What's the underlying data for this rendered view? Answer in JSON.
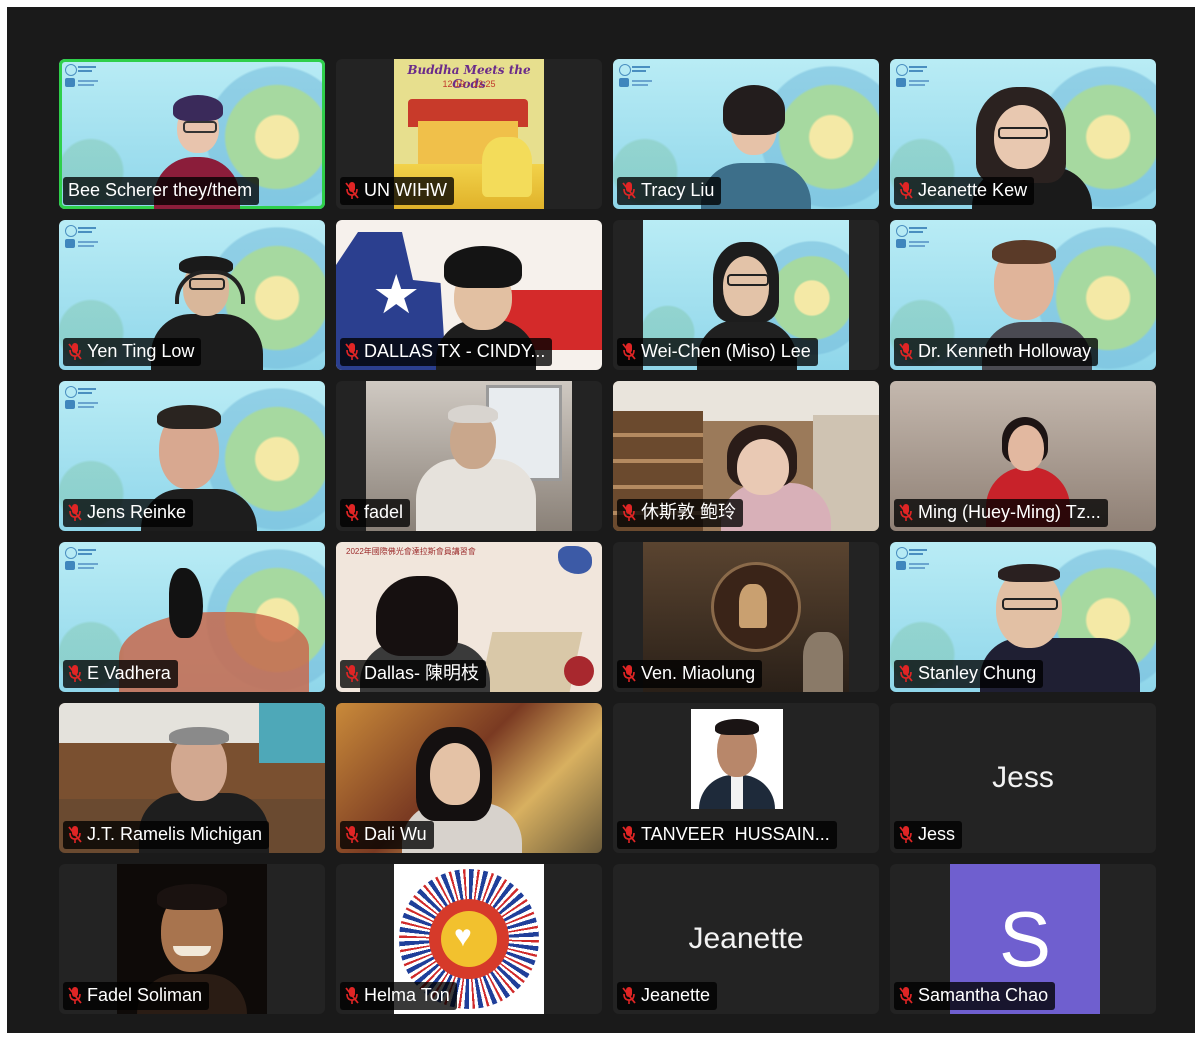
{
  "meeting": {
    "view": "gallery",
    "accent_active": "#2fcf4b",
    "tile_bg": "#232323"
  },
  "participants": [
    {
      "name": "Bee Scherer they/them",
      "muted": false,
      "active_speaker": true,
      "background": "un-theme"
    },
    {
      "name": "UN WIHW",
      "muted": true,
      "background": "poster",
      "poster_title": "Buddha Meets the Gods",
      "poster_dates": "12.19 - 12.25"
    },
    {
      "name": "Tracy Liu",
      "muted": true,
      "background": "un-theme"
    },
    {
      "name": "Jeanette Kew",
      "muted": true,
      "background": "un-theme"
    },
    {
      "name": "Yen Ting Low",
      "muted": true,
      "background": "un-theme"
    },
    {
      "name": "DALLAS TX - CINDY...",
      "muted": true,
      "background": "texas-flag"
    },
    {
      "name": "Wei-Chen (Miso) Lee",
      "muted": true,
      "background": "un-theme"
    },
    {
      "name": "Dr. Kenneth Holloway",
      "muted": true,
      "background": "un-theme"
    },
    {
      "name": "Jens Reinke",
      "muted": true,
      "background": "un-theme"
    },
    {
      "name": "fadel",
      "muted": true,
      "background": "window-room"
    },
    {
      "name": "休斯敦 鲍玲",
      "muted": true,
      "background": "bookshelf-room"
    },
    {
      "name": "Ming (Huey-Ming) Tz...",
      "muted": true,
      "background": "blurred-room"
    },
    {
      "name": "E Vadhera",
      "muted": true,
      "background": "un-theme"
    },
    {
      "name": "Dallas- 陳明枝",
      "muted": true,
      "background": "event-banner",
      "banner_text": "2022年國際佛光會達拉斯會員講習會"
    },
    {
      "name": "Ven. Miaolung",
      "muted": true,
      "background": "shrine"
    },
    {
      "name": "Stanley Chung",
      "muted": true,
      "background": "un-theme"
    },
    {
      "name": "J.T. Ramelis Michigan",
      "muted": true,
      "background": "office"
    },
    {
      "name": "Dali Wu",
      "muted": true,
      "background": "abstract-painting"
    },
    {
      "name": "TANVEER  HUSSAIN...",
      "muted": true,
      "background": "id-photo"
    },
    {
      "name": "Jess",
      "muted": true,
      "background": "name-only",
      "display_name": "Jess"
    },
    {
      "name": "Fadel Soliman",
      "muted": true,
      "background": "dark-portrait"
    },
    {
      "name": "Helma Ton",
      "muted": true,
      "background": "mandala"
    },
    {
      "name": "Jeanette",
      "muted": true,
      "background": "name-only",
      "display_name": "Jeanette"
    },
    {
      "name": "Samantha Chao",
      "muted": true,
      "background": "avatar",
      "avatar_letter": "S",
      "avatar_color": "#6f5fcf"
    }
  ]
}
